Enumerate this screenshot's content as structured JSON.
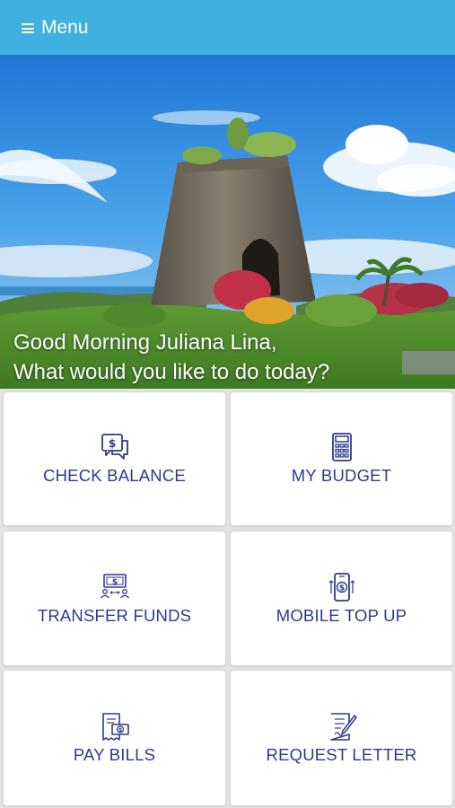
{
  "header": {
    "menu_label": "Menu"
  },
  "hero": {
    "greeting_line1": "Good Morning Juliana Lina,",
    "greeting_line2": "What would you like to do today?"
  },
  "actions": [
    {
      "label": "CHECK BALANCE",
      "icon": "balance-chat-icon"
    },
    {
      "label": "MY BUDGET",
      "icon": "calculator-icon"
    },
    {
      "label": "TRANSFER FUNDS",
      "icon": "transfer-icon"
    },
    {
      "label": "MOBILE TOP UP",
      "icon": "mobile-topup-icon"
    },
    {
      "label": "PAY BILLS",
      "icon": "bill-icon"
    },
    {
      "label": "REQUEST LETTER",
      "icon": "letter-icon"
    }
  ],
  "colors": {
    "header": "#3fb0e0",
    "tile_text": "#2e3a8c",
    "tile_bg": "#ffffff",
    "grid_bg": "#e4e4e4"
  }
}
